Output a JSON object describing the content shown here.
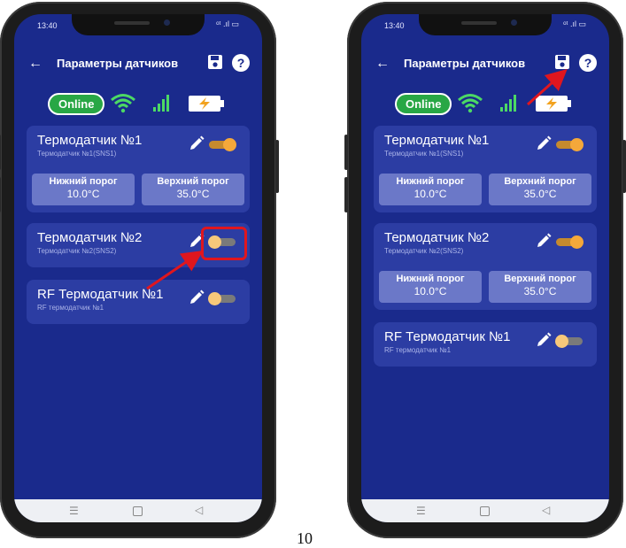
{
  "status_bar": {
    "time": "13:40",
    "icons": "ᵒᵗ .ıl ▭"
  },
  "appbar": {
    "title": "Параметры датчиков"
  },
  "status_row": {
    "online_label": "Online"
  },
  "sensors": [
    {
      "title": "Термодатчик №1",
      "subtitle": "Термодатчик №1(SNS1)",
      "low_label": "Нижний порог",
      "low_value": "10.0°C",
      "high_label": "Верхний порог",
      "high_value": "35.0°C"
    },
    {
      "title": "Термодатчик №2",
      "subtitle": "Термодатчик №2(SNS2)",
      "low_label": "Нижний порог",
      "low_value": "10.0°C",
      "high_label": "Верхний порог",
      "high_value": "35.0°C"
    },
    {
      "title": "RF Термодатчик №1",
      "subtitle": "RF термодатчик №1"
    }
  ],
  "screens": {
    "left": {
      "toggles": {
        "sensor1": "on",
        "sensor2": "off",
        "rf": "off"
      }
    },
    "right": {
      "toggles": {
        "sensor1": "on",
        "sensor2": "on",
        "rf": "off"
      }
    }
  },
  "navbar": {
    "menu_icon": "☰",
    "back_icon": "◁"
  },
  "page_number": "10",
  "colors": {
    "screen_bg": "#1a2a8c",
    "card_bg": "#2c3da3",
    "threshold_bg": "#6b78c8",
    "toggle_on": "#f4a83a",
    "online": "#28a745",
    "annotation_red": "#e0161e"
  }
}
